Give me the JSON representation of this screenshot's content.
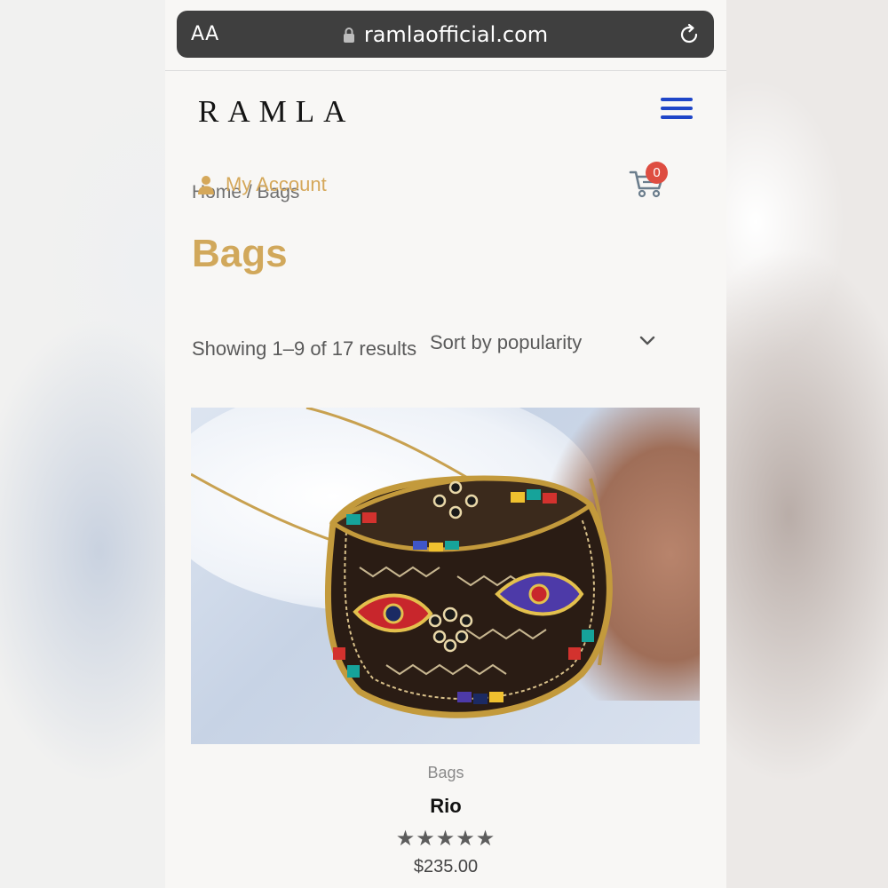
{
  "browser": {
    "text_size_label": "AA",
    "url": "ramlaofficial.com"
  },
  "header": {
    "logo_text": "RAMLA",
    "account_label": "My Account",
    "cart_count": "0"
  },
  "breadcrumb": "Home / Bags",
  "page": {
    "title": "Bags",
    "result_count": "Showing 1–9 of 17 results",
    "sort_selected": "Sort by popularity"
  },
  "product": {
    "category": "Bags",
    "name": "Rio",
    "rating": 5,
    "stars": "★★★★★",
    "price": "$235.00"
  },
  "colors": {
    "accent_gold": "#d1a85b",
    "menu_blue": "#1f46c8",
    "badge_red": "#de4d41"
  },
  "icons": [
    "lock-icon",
    "reload-icon",
    "menu-icon",
    "user-icon",
    "cart-icon",
    "chevron-down-icon",
    "star-icon"
  ]
}
